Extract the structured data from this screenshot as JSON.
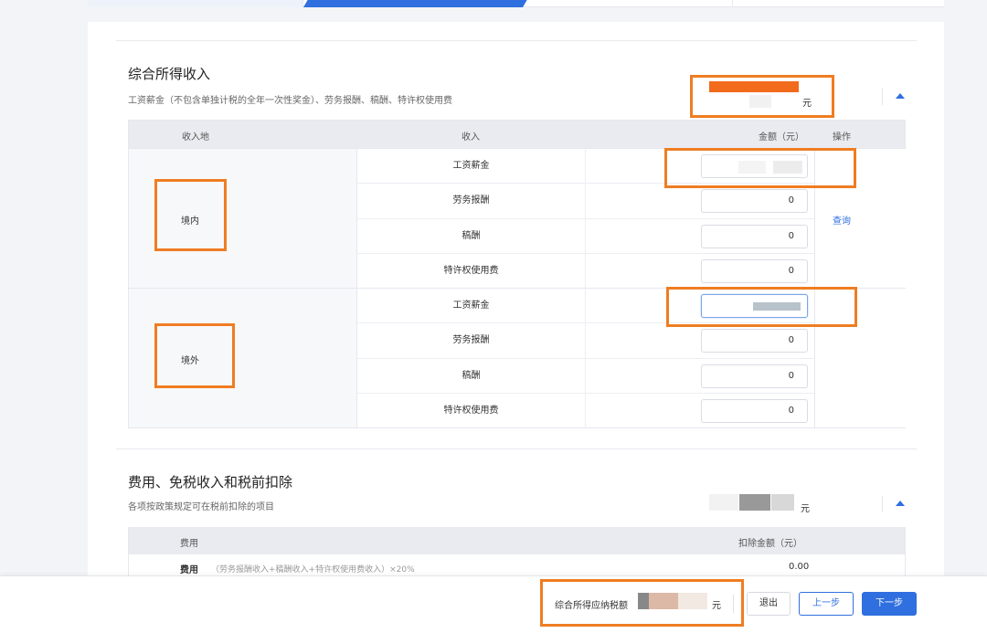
{
  "income": {
    "title": "综合所得收入",
    "subtitle": "工资薪金（不包含单独计税的全年一次性奖金）、劳务报酬、稿酬、特许权使用费",
    "unit": "元",
    "table": {
      "col_location": "收入地",
      "col_income": "收入",
      "col_amount": "金额（元）",
      "col_action": "操作",
      "domestic": {
        "location": "境内",
        "action": "查询",
        "rows": [
          {
            "category": "工资薪金",
            "value": ""
          },
          {
            "category": "劳务报酬",
            "value": "0"
          },
          {
            "category": "稿酬",
            "value": "0"
          },
          {
            "category": "特许权使用费",
            "value": "0"
          }
        ]
      },
      "overseas": {
        "location": "境外",
        "rows": [
          {
            "category": "工资薪金",
            "value": ""
          },
          {
            "category": "劳务报酬",
            "value": "0"
          },
          {
            "category": "稿酬",
            "value": "0"
          },
          {
            "category": "特许权使用费",
            "value": "0"
          }
        ]
      }
    }
  },
  "expenses": {
    "title": "费用、免税收入和税前扣除",
    "subtitle": "各项按政策规定可在税前扣除的项目",
    "unit": "元",
    "col_fee": "费用",
    "col_deduct": "扣除金额（元）",
    "row_label": "费用",
    "row_note": "（劳务报酬收入+稿酬收入+特许权使用费收入）×20%",
    "row_value": "0.00"
  },
  "footer": {
    "tax_label": "综合所得应纳税额",
    "unit": "元",
    "exit_label": "退出",
    "prev_label": "上一步",
    "next_label": "下一步"
  },
  "colors": {
    "accent": "#2f6fe0",
    "highlight": "#ef7d22"
  }
}
